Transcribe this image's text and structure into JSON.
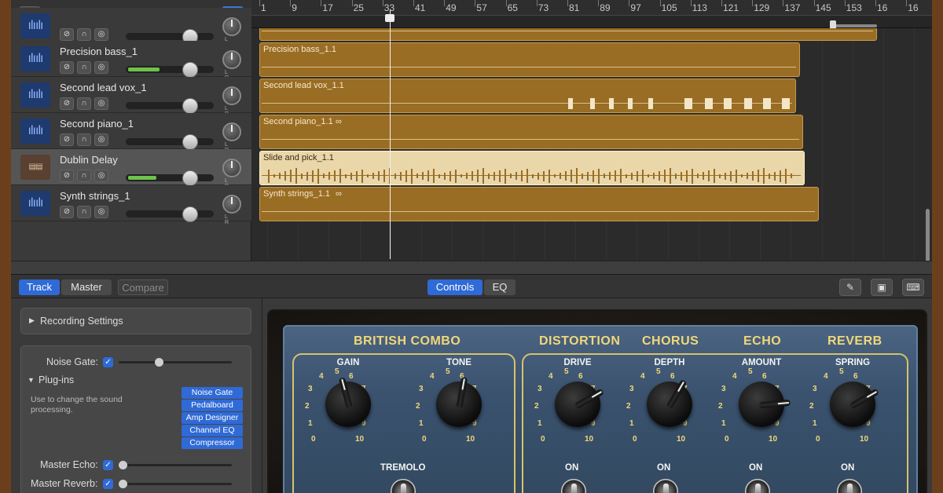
{
  "header": {
    "add_label": "+",
    "filter_label": "⏷"
  },
  "ruler": {
    "bars": [
      "1",
      "9",
      "17",
      "25",
      "33",
      "41",
      "49",
      "57",
      "65",
      "73",
      "81",
      "89",
      "97",
      "105",
      "113",
      "121",
      "129",
      "137",
      "145",
      "153",
      "16",
      "16"
    ]
  },
  "tracks": [
    {
      "name": "",
      "icon": "waveform-icon"
    },
    {
      "name": "Precision bass_1",
      "icon": "waveform-icon",
      "level": 0.36
    },
    {
      "name": "Second lead vox_1",
      "icon": "waveform-icon",
      "level": 0
    },
    {
      "name": "Second piano_1",
      "icon": "waveform-icon",
      "level": 0
    },
    {
      "name": "Dublin Delay",
      "icon": "amp-icon",
      "level": 0.32,
      "selected": true
    },
    {
      "name": "Synth strings_1",
      "icon": "waveform-icon",
      "level": 0
    }
  ],
  "regions": [
    {
      "name": ""
    },
    {
      "name": "Precision bass_1.1"
    },
    {
      "name": "Second lead vox_1.1"
    },
    {
      "name": "Second piano_1.1",
      "loop": "∞"
    },
    {
      "name": "Slide and pick_1.1"
    },
    {
      "name": "Synth strings_1.1",
      "loop": "∞"
    }
  ],
  "bottom_tabs": {
    "track": "Track",
    "master": "Master",
    "compare": "Compare",
    "controls": "Controls",
    "eq": "EQ"
  },
  "settings": {
    "recording_settings": "Recording Settings",
    "noise_gate": "Noise Gate:",
    "plugins": "Plug-ins",
    "plugins_desc": "Use to change the sound processing.",
    "plugin_list": [
      "Noise Gate",
      "Pedalboard",
      "Amp Designer",
      "Channel EQ",
      "Compressor"
    ],
    "master_echo": "Master Echo:",
    "master_reverb": "Master Reverb:"
  },
  "amp": {
    "sections": {
      "british_combo": "BRITISH COMBO",
      "distortion": "DISTORTION",
      "chorus": "CHORUS",
      "echo": "ECHO",
      "reverb": "REVERB"
    },
    "knobs": {
      "gain": "GAIN",
      "tone": "TONE",
      "drive": "DRIVE",
      "depth": "DEPTH",
      "amount": "AMOUNT",
      "spring": "SPRING"
    },
    "tremolo": "TREMOLO",
    "on": "ON",
    "scale": [
      "0",
      "1",
      "2",
      "3",
      "4",
      "5",
      "6",
      "7",
      "8",
      "9",
      "10"
    ]
  },
  "colors": {
    "accent": "#2f6ad6",
    "region": "#9a6d24",
    "amp_panel": "#3a526e",
    "amp_label": "#f0d87a"
  }
}
